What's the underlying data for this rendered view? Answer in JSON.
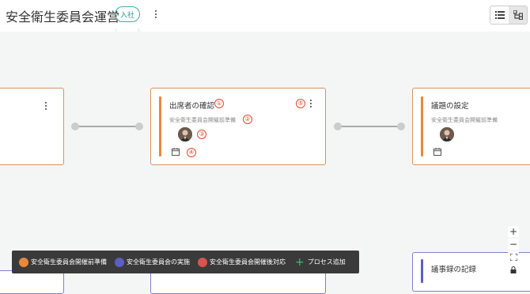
{
  "header": {
    "title": "安全衛生委員会運営",
    "badge": "入社"
  },
  "cards": [
    {
      "title": "出席者の確認",
      "subtitle": "安全衛生委員会開催前準備",
      "avatar_icon": "person-avatar",
      "calendar_icon": "calendar-icon"
    },
    {
      "title": "議題の設定",
      "subtitle": "安全衛生委員会開催前準備",
      "avatar_icon": "person-avatar",
      "calendar_icon": "calendar-icon"
    },
    {
      "title": "議事録の記録"
    }
  ],
  "annotations": [
    "①",
    "②",
    "③",
    "④",
    "⑤"
  ],
  "legend": {
    "items": [
      {
        "label": "安全衛生委員会開催前準備",
        "color": "#e8883a"
      },
      {
        "label": "安全衛生委員会の実施",
        "color": "#5a5fc0"
      },
      {
        "label": "安全衛生委員会開催後対応",
        "color": "#d9534f"
      }
    ],
    "add_label": "プロセス追加"
  },
  "zoom": {
    "in": "+",
    "out": "−"
  }
}
